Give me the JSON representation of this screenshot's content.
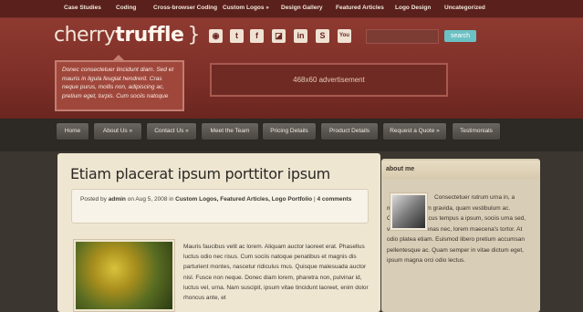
{
  "topnav": {
    "items": [
      "Case Studies",
      "Coding",
      "Cross-browser Coding",
      "Custom Logos »",
      "Design Gallery",
      "Featured Articles",
      "Logo Design",
      "Uncategorized"
    ]
  },
  "header": {
    "logo_light": "cherry",
    "logo_bold": "truffle",
    "logo_brace": "}",
    "social": [
      "rss-icon",
      "twitter-icon",
      "facebook-icon",
      "delicious-icon",
      "linkedin-icon",
      "stumbleupon-icon",
      "youtube-icon"
    ],
    "social_glyphs": [
      "◉",
      "t",
      "f",
      "◪",
      "in",
      "S",
      "You"
    ],
    "search_placeholder": "",
    "search_button": "search",
    "blurb": "Donec consectetuer tincidunt diam. Sed et mauris in ligula feugiat hendrerit. Cras neque purus, mollis non, adipiscing ac, pretium eget, turpis. Cum sociis natoque",
    "ad_label": "468x60 advertisement"
  },
  "mainnav": {
    "items": [
      "Home",
      "About Us »",
      "Contact Us »",
      "Meet the Team",
      "Pricing Details",
      "Product Details",
      "Request a Quote »",
      "Testimonials"
    ]
  },
  "post": {
    "title": "Etiam placerat ipsum porttitor ipsum",
    "meta_prefix": "Posted by",
    "author": "admin",
    "meta_on": "on Aug 5, 2008 in",
    "categories": "Custom Logos, Featured Articles, Logo Portfolio",
    "meta_sep": "|",
    "comments": "4 comments",
    "body": "Mauris faucibus velit ac lorem. Aliquam auctor laoreet erat. Phasellus luctus odio nec risus. Cum sociis natoque penatibus et magnis dis parturient montes, nascetur ridiculus mus. Quisque malesuada auctor nisl. Fusce non neque. Donec diam lorem, pharetra non, pulvinar id, luctus vel, urna. Nam suscipit, ipsum vitae tincidunt laoreet, enim dolor rhoncus ante, et"
  },
  "sidebar": {
    "heading": "about me",
    "text": "Consectetuer rutrum urna in, a molestie aliquam gravida, quam vestibulum ac. Consequat ut lacus tempus a ipsum, sociis urna sed, vel tellus maecenas nec, lorem maecena's tortor. At odio platea etiam. Euismod libero pretium accumsan pellentesque ac. Quam semper in vitae dictum eget, ipsum magna orci odio lectus."
  }
}
